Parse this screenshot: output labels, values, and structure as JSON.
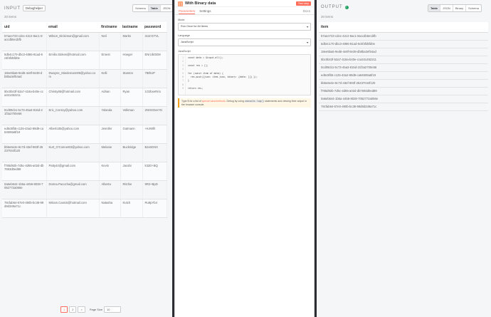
{
  "input": {
    "title": "INPUT",
    "source_select": "Debughelper",
    "tabs": [
      "Schema",
      "Table",
      "JSON"
    ],
    "active_tab": "Table",
    "count": "20 items",
    "columns": [
      "uid",
      "email",
      "firstname",
      "lastname",
      "password"
    ],
    "rows": [
      [
        "57aee723-cdec-42c2-8ac1-8accdb5e1bfb",
        "Wilson_Dickinson@gmail.com",
        "Neil",
        "Marks",
        "3cIZ-D7VL"
      ],
      [
        "5db4c170-dbc3-4865-81ad-6c5f4fd5fd0e",
        "Emilio.Stokes@hotmail.com",
        "Ernest",
        "Hoeger",
        "ENrUbGEM"
      ],
      [
        "18ee5ba5-9ed6-4e8f-8e39-db8ba3ef54ad",
        "Dwayne_Stiedemann99@yahoo.com",
        "Kelli",
        "Stanton",
        "7tBhUP"
      ],
      [
        "5bc0b43f-52a7-418a-b40e-cca341452211",
        "Christy65@hotmail.com",
        "Adrian",
        "Ryan",
        "1O2bxeRrio"
      ],
      [
        "0cd08cb1-5c73-45a3-815d-21f3a2700e56",
        "Eric_Conroy@yahoo.com",
        "Yolanda",
        "Volkman",
        "2NrSG5erYD"
      ],
      [
        "ed6c5fb5-c125-43a2-89d9-ca64508a5f19",
        "Alberto35@yahoo.com",
        "Jennifer",
        "Gutmann",
        "+K4Wlh"
      ],
      [
        "bb5e6e2e-8c7d-43ef-983f-25237044f120",
        "Kurt_O'Conner83@yahoo.com",
        "Melanie",
        "Buckridge",
        "BJx6GNX"
      ],
      [
        "f785d92b-7d5c-4d65-a02d-db7693d0ed89",
        "Patty44@gmail.com",
        "Kevin",
        "Jacobi",
        "k32D+BQ"
      ],
      [
        "0a6eb644-1b5a-4456-8028-7052772a056e",
        "Donna.Pacocha@gmail.com",
        "Alberta",
        "Ritchie",
        "9R2+BpD"
      ],
      [
        "78cfab64-67e0-490b-bc38-99d8d349a71c",
        "Miriam.Cassin@hotmail.com",
        "Natasha",
        "Kutch",
        "Ru9pYb4"
      ]
    ],
    "pager": {
      "pages": [
        "1",
        "2"
      ],
      "active": "1",
      "next": ">",
      "page_size_label": "Page Size",
      "page_size": "10"
    }
  },
  "node": {
    "title": "With Binary data",
    "test_button": "Test step",
    "tabs": [
      "Parameters",
      "Settings"
    ],
    "active_tab": "Parameters",
    "docs": "Docs",
    "mode_label": "Mode",
    "mode_value": "Run Once for All Items",
    "language_label": "Language",
    "language_value": "JavaScript",
    "code_label": "JavaScript",
    "code_lines": [
      "const data = $input.all();",
      "",
      "const res = [];",
      "",
      "for (const item of data) {",
      "  res.push({json: item.json, binary: {data: []} });",
      "}",
      "",
      "return res;"
    ],
    "notice_pre": "Type $ for a list of",
    "notice_link": "special vars/methods",
    "notice_mid": ". Debug by using",
    "notice_code": "console.log()",
    "notice_post": "statements and viewing their output in the browser console."
  },
  "output": {
    "title": "OUTPUT",
    "tabs": [
      "Table",
      "JSON",
      "Binary",
      "Schema"
    ],
    "active_tab": "Table",
    "count": "20 items",
    "column": "item",
    "rows": [
      "57aee723-cdec-42c2-8ac1-8accdb5e1bfb",
      "5db4c170-dbc3-4865-81ad-6c5f4fd5fd0e",
      "18ee5ba5-9ed6-4e8f-8e39-db8ba3ef54ad",
      "5bc0b43f-52a7-418a-b40e-cca341452211",
      "0cd08cb1-5c73-45a3-815d-21f3a2700e56",
      "ed6c5fb5-c125-43a2-89d9-ca64508a5f19",
      "bb5e6e2e-8c7d-43ef-983f-25237044f120",
      "f785d92b-7d5c-4d65-a02d-db7693d0ed89",
      "0a6eb644-1b5a-4456-8028-7052772a056e",
      "78cfab64-67e0-490b-bc38-99d8d349a71c"
    ]
  }
}
